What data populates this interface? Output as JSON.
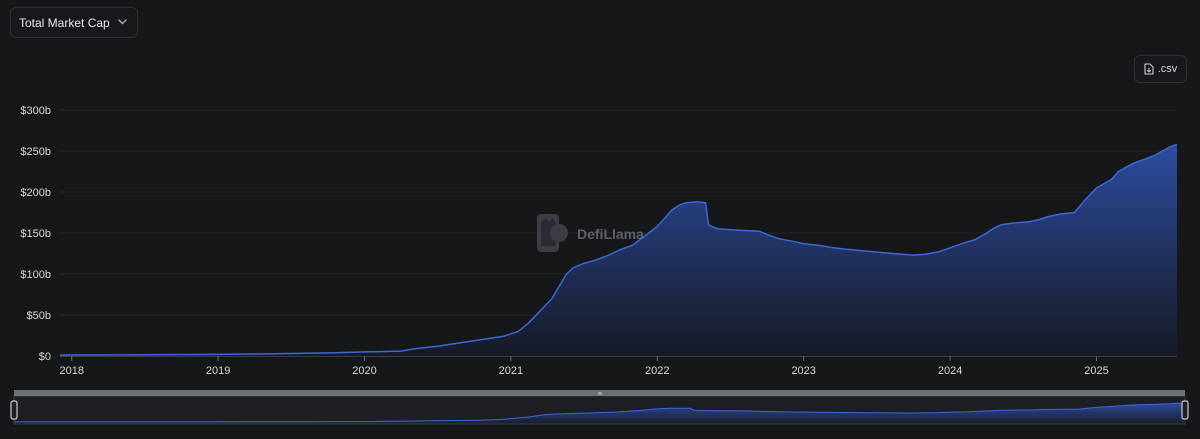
{
  "header": {
    "metric_select_label": "Total Market Cap",
    "chevron_icon": "chevron-down-icon"
  },
  "toolbar": {
    "csv_label": ".csv",
    "csv_icon": "file-download-icon"
  },
  "watermark": {
    "text": "DefiLlama",
    "icon": "llama-logo-icon"
  },
  "colors": {
    "line": "#3c67d6",
    "area_top": "#2d4fa8",
    "area_bottom": "#161a26",
    "grid": "#232529",
    "background": "#161719"
  },
  "chart_data": {
    "type": "area",
    "title": "",
    "xlabel": "",
    "ylabel": "",
    "y_ticks": [
      0,
      50,
      100,
      150,
      200,
      250,
      300
    ],
    "y_tick_labels": [
      "$0",
      "$50b",
      "$100b",
      "$150b",
      "$200b",
      "$250b",
      "$300b"
    ],
    "ylim": [
      0,
      300
    ],
    "x_ticks": [
      2018,
      2019,
      2020,
      2021,
      2022,
      2023,
      2024,
      2025
    ],
    "x_tick_labels": [
      "2018",
      "2019",
      "2020",
      "2021",
      "2022",
      "2023",
      "2024",
      "2025"
    ],
    "xlim": [
      2017.92,
      2025.55
    ],
    "grid": "horizontal",
    "legend": "none",
    "series": [
      {
        "x": [
          2017.92,
          2018.0,
          2018.5,
          2019.0,
          2019.5,
          2019.8,
          2020.0,
          2020.15,
          2020.25,
          2020.35,
          2020.5,
          2020.65,
          2020.8,
          2020.95,
          2021.05,
          2021.12,
          2021.2,
          2021.28,
          2021.33,
          2021.38,
          2021.43,
          2021.5,
          2021.58,
          2021.67,
          2021.75,
          2021.83,
          2021.92,
          2022.0,
          2022.05,
          2022.1,
          2022.15,
          2022.2,
          2022.27,
          2022.33,
          2022.35,
          2022.37,
          2022.42,
          2022.5,
          2022.6,
          2022.7,
          2022.75,
          2022.83,
          2022.92,
          2023.0,
          2023.1,
          2023.2,
          2023.3,
          2023.42,
          2023.55,
          2023.67,
          2023.75,
          2023.83,
          2023.92,
          2024.0,
          2024.08,
          2024.17,
          2024.25,
          2024.3,
          2024.35,
          2024.42,
          2024.5,
          2024.55,
          2024.6,
          2024.67,
          2024.75,
          2024.8,
          2024.85,
          2024.92,
          2025.0,
          2025.05,
          2025.1,
          2025.15,
          2025.2,
          2025.25,
          2025.33,
          2025.4,
          2025.45,
          2025.5,
          2025.55
        ],
        "values": [
          1,
          1.2,
          1.5,
          2,
          3,
          4,
          5,
          5.5,
          6,
          9,
          12,
          16,
          20,
          24,
          30,
          40,
          55,
          70,
          85,
          100,
          108,
          113,
          117,
          123,
          130,
          135,
          147,
          158,
          168,
          178,
          184,
          187,
          188,
          187,
          160,
          158,
          155,
          154,
          153,
          152,
          148,
          143,
          140,
          137,
          135,
          132,
          130,
          128,
          126,
          124,
          123,
          124,
          127,
          132,
          137,
          142,
          150,
          156,
          160,
          162,
          163,
          164,
          166,
          170,
          173,
          174,
          175,
          190,
          205,
          210,
          215,
          225,
          230,
          235,
          240,
          245,
          250,
          255,
          258
        ]
      }
    ]
  }
}
